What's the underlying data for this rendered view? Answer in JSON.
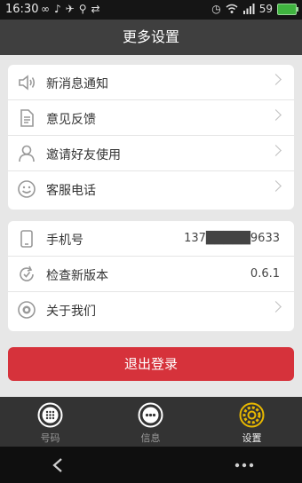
{
  "status_bar": {
    "time": "16:30",
    "battery_level": "59",
    "left_icons": [
      "link-icon",
      "music-icon",
      "bird-icon",
      "share-icon",
      "usb-icon"
    ],
    "right_icons": [
      "alarm-icon",
      "wifi-icon",
      "signal-icon",
      "battery-icon"
    ]
  },
  "header": {
    "title": "更多设置"
  },
  "card1": {
    "items": [
      {
        "label": "新消息通知",
        "icon": "speaker-icon"
      },
      {
        "label": "意见反馈",
        "icon": "document-icon"
      },
      {
        "label": "邀请好友使用",
        "icon": "person-icon"
      },
      {
        "label": "客服电话",
        "icon": "smiley-icon"
      }
    ]
  },
  "card2": {
    "items": [
      {
        "label": "手机号",
        "value": "137█████9633",
        "icon": "phone-icon"
      },
      {
        "label": "检查新版本",
        "value": "0.6.1",
        "icon": "refresh-icon"
      },
      {
        "label": "关于我们",
        "icon": "camera-icon"
      }
    ]
  },
  "logout": {
    "label": "退出登录"
  },
  "tabs": [
    {
      "label": "号码",
      "icon": "dialpad-icon",
      "active": false
    },
    {
      "label": "信息",
      "icon": "chat-icon",
      "active": false
    },
    {
      "label": "设置",
      "icon": "gear-icon",
      "active": true
    }
  ],
  "colors": {
    "accent": "#d6323b",
    "title_bar": "#3f3f3f",
    "tab_active": "#e8b800",
    "background": "#e7e7e7"
  },
  "nav": {
    "back_icon": "back-icon",
    "menu_icon": "menu-icon"
  }
}
